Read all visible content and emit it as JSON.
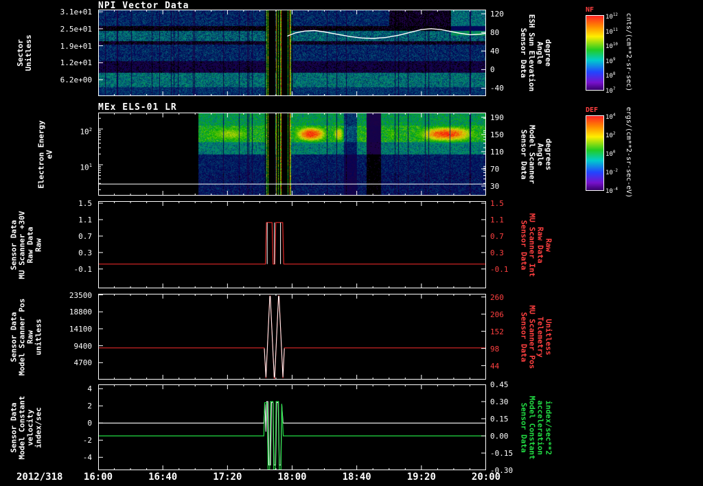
{
  "meta": {
    "date_label": "2012/318",
    "description": "Multi-panel time-series display of NPI and MEx ELS-01 LR sensor data from 16:00 to 20:00 on day 2012/318"
  },
  "x_axis": {
    "tick_labels": [
      "16:00",
      "16:40",
      "17:20",
      "18:00",
      "18:40",
      "19:20",
      "20:00"
    ],
    "major_step_minutes": 40,
    "minor_step_minutes": 10,
    "span_minutes": 240
  },
  "colorbars": [
    {
      "name": "NF",
      "title": "NF",
      "title_color": "#ff4040",
      "unit": "cnts/(cm**2-sr-sec)",
      "tick_exps": [
        "12",
        "11",
        "10",
        "9",
        "8",
        "7"
      ]
    },
    {
      "name": "DEF",
      "title": "DEF",
      "title_color": "#ff4040",
      "unit": "ergs/(cm**2-sr-sec-eV)",
      "tick_exps": [
        "4",
        "2",
        "0",
        "-2",
        "-4"
      ]
    }
  ],
  "chart_data": {
    "type": "multi-panel time series: 2 spectrogram heatmaps + 3 line plots",
    "panels": [
      {
        "id": "npi-vector-data",
        "kind": "heatmap",
        "title": "NPI Vector Data",
        "left_label_lines": [
          "Sector",
          "Unitless"
        ],
        "left_ticks": [
          {
            "label": "3.1e+01",
            "v": 31
          },
          {
            "label": "2.5e+01",
            "v": 24.8
          },
          {
            "label": "1.9e+01",
            "v": 18.6
          },
          {
            "label": "1.2e+01",
            "v": 12.4
          },
          {
            "label": "6.2e+00",
            "v": 6.2
          }
        ],
        "left_range": [
          0.2,
          31.8
        ],
        "right_label_lines": [
          "Sensor Data",
          "ESH Sun Elevation",
          "Angle",
          "degree"
        ],
        "right_label_color": "#ffffff",
        "right_ticks": [
          {
            "label": "120",
            "v": 120
          },
          {
            "label": "80",
            "v": 80
          },
          {
            "label": "40",
            "v": 40
          },
          {
            "label": "0",
            "v": 0
          },
          {
            "label": "-40",
            "v": -40
          }
        ],
        "right_range": [
          -57,
          129
        ],
        "heatmap": {
          "bands": [
            [
              0,
              0.19,
              0.2,
              0.1
            ],
            [
              0.19,
              0.24,
              0.02,
              0.02
            ],
            [
              0.24,
              0.36,
              0.3,
              0.12
            ],
            [
              0.36,
              0.4,
              0.03,
              0.02
            ],
            [
              0.4,
              0.59,
              0.2,
              0.1
            ],
            [
              0.59,
              0.73,
              0.06,
              0.05
            ],
            [
              0.73,
              0.89,
              0.33,
              0.12
            ],
            [
              0.89,
              1,
              0.22,
              0.08
            ]
          ],
          "event": {
            "t0": 103,
            "t1": 120
          },
          "patches": [
            {
              "t0": 180,
              "t1": 218,
              "f0": 0,
              "f1": 0.19,
              "mult": 0.15
            },
            {
              "t0": 218,
              "t1": 240,
              "f0": 0,
              "f1": 0.3,
              "add": 0.12
            }
          ]
        },
        "overlays": [
          {
            "name": "esh-sun-elevation",
            "color": "#ffffff",
            "axis": "right",
            "width": 1.4,
            "points": [
              [
                117,
                72
              ],
              [
                122,
                79
              ],
              [
                128,
                83
              ],
              [
                134,
                84
              ],
              [
                140,
                81
              ],
              [
                148,
                76
              ],
              [
                156,
                71
              ],
              [
                163,
                68
              ],
              [
                170,
                67
              ],
              [
                178,
                69
              ],
              [
                186,
                74
              ],
              [
                193,
                80
              ],
              [
                200,
                86
              ],
              [
                206,
                88
              ],
              [
                212,
                86
              ],
              [
                218,
                82
              ],
              [
                224,
                78
              ],
              [
                230,
                75
              ],
              [
                236,
                76
              ],
              [
                240,
                78
              ]
            ]
          }
        ]
      },
      {
        "id": "mex-els-01-lr",
        "kind": "heatmap",
        "title": "MEx ELS-01 LR",
        "log_minor": true,
        "left_label_lines": [
          "Electron Energy",
          "eV"
        ],
        "left_ticks": [
          {
            "label": "10",
            "exp": "2",
            "v": 2
          },
          {
            "label": "10",
            "exp": "1",
            "v": 1
          }
        ],
        "left_range": [
          0.135,
          2.46
        ],
        "right_label_lines": [
          "Sensor Data",
          "Model Scanner",
          "Angle",
          "degrees"
        ],
        "right_label_color": "#ffffff",
        "right_ticks": [
          {
            "label": "190",
            "v": 190
          },
          {
            "label": "150",
            "v": 150
          },
          {
            "label": "110",
            "v": 110
          },
          {
            "label": "70",
            "v": 70
          },
          {
            "label": "30",
            "v": 30
          }
        ],
        "right_range": [
          7.6,
          201
        ],
        "heatmap": {
          "data_start_t": 62,
          "bands": [
            [
              0,
              0.15,
              0.45,
              0.15
            ],
            [
              0.15,
              0.35,
              0.55,
              0.15
            ],
            [
              0.35,
              0.5,
              0.36,
              0.12
            ],
            [
              0.5,
              0.72,
              0.18,
              0.08
            ],
            [
              0.72,
              1,
              0.16,
              0.1
            ]
          ],
          "hot_band": [
            0.13,
            0.38
          ],
          "blobs": [
            {
              "t0": 63,
              "t1": 100,
              "peak": 0.72
            },
            {
              "t0": 119,
              "t1": 144,
              "peak": 0.97
            },
            {
              "t0": 144,
              "t1": 153,
              "peak": 0.82
            },
            {
              "t0": 177,
              "t1": 187,
              "peak": 0.62
            },
            {
              "t0": 193,
              "t1": 238,
              "peak": 0.96
            }
          ],
          "gaps": [
            {
              "t0": 152,
              "t1": 160,
              "mult": 0.5
            },
            {
              "t0": 166,
              "t1": 175,
              "mult": 0.12
            }
          ],
          "event": {
            "t0": 103,
            "t1": 119
          }
        },
        "overlays": [
          {
            "name": "energy-marker",
            "color": "#ffffff",
            "axis": "left",
            "width": 1,
            "points": [
              [
                0,
                0.46
              ],
              [
                240,
                0.46
              ]
            ]
          }
        ]
      },
      {
        "id": "mu-scanner-30v",
        "kind": "line",
        "left_label_lines": [
          "Sensor Data",
          "MU Scanner +30V",
          "Raw Data",
          "Raw"
        ],
        "left_ticks": [
          {
            "label": "1.5",
            "v": 1.5
          },
          {
            "label": "1.1",
            "v": 1.1
          },
          {
            "label": "0.7",
            "v": 0.7
          },
          {
            "label": "0.3",
            "v": 0.3
          },
          {
            "label": "-0.1",
            "v": -0.1
          }
        ],
        "left_range": [
          -0.57,
          1.55
        ],
        "right_label_lines": [
          "Sensor Data",
          "MU Scanner Int",
          "Raw Data",
          "Raw"
        ],
        "right_label_color": "#ff4040",
        "right_tick_color": "#ff4040",
        "right_ticks": [
          {
            "label": "1.5",
            "v": 1.5
          },
          {
            "label": "1.1",
            "v": 1.1
          },
          {
            "label": "0.7",
            "v": 0.7
          },
          {
            "label": "0.3",
            "v": 0.3
          },
          {
            "label": "-0.1",
            "v": -0.1
          }
        ],
        "right_range": [
          -0.57,
          1.55
        ],
        "series": [
          {
            "name": "mu-scanner-30v-raw",
            "color": "#e02828",
            "axis": "left",
            "width": 1.2,
            "points": [
              [
                0,
                0.02
              ],
              [
                103.5,
                0.02
              ],
              [
                104.1,
                1.03
              ],
              [
                107.6,
                1.03
              ],
              [
                108.2,
                0.02
              ],
              [
                109.3,
                0.02
              ],
              [
                109.9,
                1.03
              ],
              [
                114.2,
                1.03
              ],
              [
                114.8,
                0.02
              ],
              [
                240,
                0.02
              ]
            ]
          },
          {
            "name": "mu-scanner-int-spike-a",
            "color": "#ffffff",
            "axis": "left",
            "width": 1,
            "points": [
              [
                104.6,
                0.02
              ],
              [
                104.6,
                1.03
              ]
            ]
          },
          {
            "name": "mu-scanner-int-spike-b",
            "color": "#ffffff",
            "axis": "left",
            "width": 1,
            "points": [
              [
                109.1,
                0.02
              ],
              [
                109.1,
                1.03
              ]
            ]
          },
          {
            "name": "mu-scanner-int-spike-c",
            "color": "#ffffff",
            "axis": "left",
            "width": 1,
            "points": [
              [
                112.8,
                0.02
              ],
              [
                112.8,
                1.03
              ]
            ]
          }
        ]
      },
      {
        "id": "model-scanner-pos",
        "kind": "line",
        "left_label_lines": [
          "Sensor Data",
          "Model Scanner Pos",
          "Raw",
          "unitless"
        ],
        "left_ticks": [
          {
            "label": "23500",
            "v": 23500
          },
          {
            "label": "18800",
            "v": 18800
          },
          {
            "label": "14100",
            "v": 14100
          },
          {
            "label": "9400",
            "v": 9400
          },
          {
            "label": "4700",
            "v": 4700
          }
        ],
        "left_range": [
          0,
          23800
        ],
        "right_label_lines": [
          "Sensor Data",
          "MU Scanner Pos",
          "Telemetry",
          "Unitless"
        ],
        "right_label_color": "#ff4040",
        "right_tick_color": "#ff4040",
        "right_ticks": [
          {
            "label": "260",
            "v": 260
          },
          {
            "label": "206",
            "v": 206
          },
          {
            "label": "152",
            "v": 152
          },
          {
            "label": "98",
            "v": 98
          },
          {
            "label": "44",
            "v": 44
          }
        ],
        "right_range": [
          0,
          270
        ],
        "series": [
          {
            "name": "model-scanner-pos-raw",
            "color": "#e02828",
            "axis": "left",
            "width": 1.2,
            "points": [
              [
                0,
                8800
              ],
              [
                102.8,
                8800
              ],
              [
                103.8,
                400
              ],
              [
                106.2,
                23200
              ],
              [
                106.5,
                23200
              ],
              [
                108.9,
                400
              ],
              [
                109.2,
                400
              ],
              [
                111.6,
                23200
              ],
              [
                111.9,
                23200
              ],
              [
                114.3,
                400
              ],
              [
                115.2,
                8800
              ],
              [
                240,
                8800
              ]
            ]
          },
          {
            "name": "mu-scanner-pos-telemetry",
            "color": "#ffffff",
            "axis": "right",
            "width": 1,
            "points": [
              [
                102.8,
                98
              ],
              [
                103.8,
                8
              ],
              [
                106.2,
                262
              ],
              [
                106.5,
                262
              ],
              [
                108.9,
                8
              ],
              [
                109.2,
                8
              ],
              [
                111.6,
                262
              ],
              [
                111.9,
                262
              ],
              [
                114.3,
                8
              ],
              [
                115.2,
                98
              ]
            ]
          }
        ]
      },
      {
        "id": "model-constant-velocity",
        "kind": "line",
        "left_label_lines": [
          "Sensor Data",
          "Model Constant",
          "velocity",
          "index/sec"
        ],
        "left_ticks": [
          {
            "label": "4",
            "v": 4
          },
          {
            "label": "2",
            "v": 2
          },
          {
            "label": "0",
            "v": 0
          },
          {
            "label": "-2",
            "v": -2
          },
          {
            "label": "-4",
            "v": -4
          }
        ],
        "left_range": [
          -5.5,
          4.5
        ],
        "right_label_lines": [
          "Sensor Data",
          "Model Constant",
          "acceleration",
          "index/sec**2"
        ],
        "right_label_color": "#22dd44",
        "right_tick_color": "#ffffff",
        "right_ticks": [
          {
            "label": "0.45",
            "v": 0.45
          },
          {
            "label": "0.30",
            "v": 0.3
          },
          {
            "label": "0.15",
            "v": 0.15
          },
          {
            "label": "0.00",
            "v": 0
          },
          {
            "label": "-0.15",
            "v": -0.15
          },
          {
            "label": "-0.30",
            "v": -0.3
          }
        ],
        "right_range": [
          -0.3,
          0.45
        ],
        "series": [
          {
            "name": "model-constant-velocity",
            "color": "#ffffff",
            "axis": "left",
            "width": 1.1,
            "points": [
              [
                0,
                0
              ],
              [
                102.5,
                0
              ],
              [
                103.2,
                2.2
              ],
              [
                103.8,
                -1
              ],
              [
                104.3,
                2.5
              ],
              [
                105,
                2.5
              ],
              [
                105.6,
                -4.9
              ],
              [
                106.6,
                -4.9
              ],
              [
                107.2,
                2.4
              ],
              [
                108.2,
                2.4
              ],
              [
                108.8,
                -4.9
              ],
              [
                109.8,
                -4.9
              ],
              [
                110.4,
                2.4
              ],
              [
                111.4,
                2.4
              ],
              [
                112,
                -4.9
              ],
              [
                113,
                -4.9
              ],
              [
                113.6,
                2.2
              ],
              [
                114.4,
                0
              ],
              [
                240,
                0
              ]
            ]
          },
          {
            "name": "model-constant-acceleration",
            "color": "#22dd44",
            "axis": "right",
            "width": 1.2,
            "points": [
              [
                0,
                0
              ],
              [
                102.5,
                0
              ],
              [
                103,
                0.29
              ],
              [
                104.6,
                0.29
              ],
              [
                105.1,
                -0.44
              ],
              [
                106.1,
                -0.44
              ],
              [
                106.6,
                0.3
              ],
              [
                108.1,
                0.3
              ],
              [
                108.6,
                -0.44
              ],
              [
                109.6,
                -0.44
              ],
              [
                110.1,
                0.3
              ],
              [
                111.6,
                0.3
              ],
              [
                112.1,
                -0.44
              ],
              [
                113.1,
                -0.44
              ],
              [
                113.6,
                0.28
              ],
              [
                114.5,
                0
              ],
              [
                240,
                0
              ]
            ]
          }
        ]
      }
    ]
  }
}
